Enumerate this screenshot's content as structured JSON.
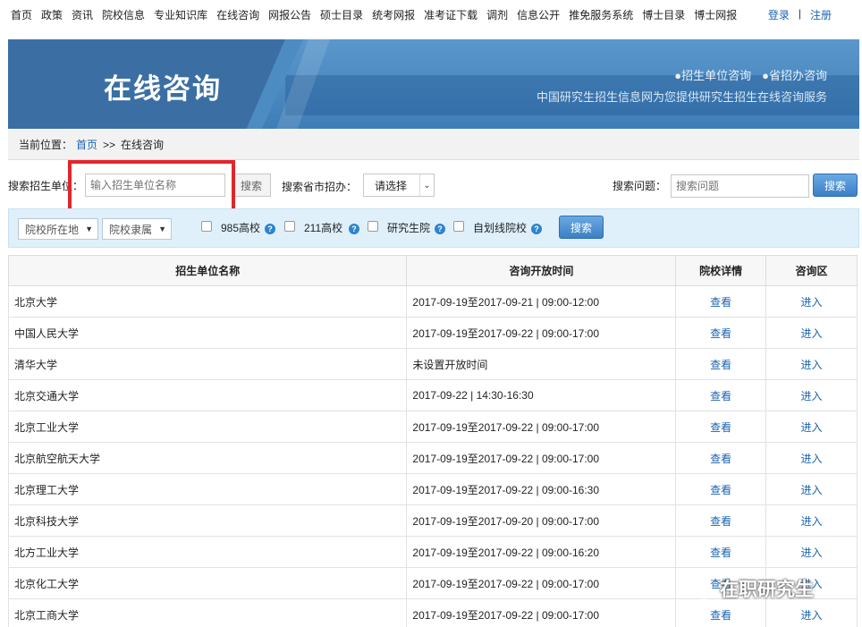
{
  "topnav": {
    "items": [
      "首页",
      "政策",
      "资讯",
      "院校信息",
      "专业知识库",
      "在线咨询",
      "网报公告",
      "硕士目录",
      "统考网报",
      "准考证下载",
      "调剂",
      "信息公开",
      "推免服务系统",
      "博士目录",
      "博士网报"
    ],
    "login": "登录",
    "separator": "|",
    "register": "注册"
  },
  "banner": {
    "title": "在线咨询",
    "link1": "●招生单位咨询",
    "link2": "●省招办咨询",
    "description": "中国研究生招生信息网为您提供研究生招生在线咨询服务"
  },
  "breadcrumb": {
    "prefix": "当前位置：",
    "home": "首页",
    "arrow": ">>",
    "current": "在线咨询"
  },
  "search": {
    "unit_label": "搜索招生单位：",
    "unit_placeholder": "输入招生单位名称",
    "unit_button": "搜索",
    "province_label": "搜索省市招办：",
    "province_select": "请选择",
    "question_label": "搜索问题：",
    "question_placeholder": "搜索问题",
    "question_button": "搜索"
  },
  "filter": {
    "location": "院校所在地",
    "affiliation": "院校隶属",
    "check985": "985高校",
    "check211": "211高校",
    "graduate_school": "研究生院",
    "self_line": "自划线院校",
    "button": "搜索",
    "help_glyph": "?"
  },
  "table": {
    "headers": [
      "招生单位名称",
      "咨询开放时间",
      "院校详情",
      "咨询区"
    ],
    "view_label": "查看",
    "enter_label": "进入",
    "rows": [
      {
        "name": "北京大学",
        "time": "2017-09-19至2017-09-21 | 09:00-12:00"
      },
      {
        "name": "中国人民大学",
        "time": "2017-09-19至2017-09-22 | 09:00-17:00"
      },
      {
        "name": "清华大学",
        "time": "未设置开放时间"
      },
      {
        "name": "北京交通大学",
        "time": "2017-09-22 | 14:30-16:30"
      },
      {
        "name": "北京工业大学",
        "time": "2017-09-19至2017-09-22 | 09:00-17:00"
      },
      {
        "name": "北京航空航天大学",
        "time": "2017-09-19至2017-09-22 | 09:00-17:00"
      },
      {
        "name": "北京理工大学",
        "time": "2017-09-19至2017-09-22 | 09:00-16:30"
      },
      {
        "name": "北京科技大学",
        "time": "2017-09-19至2017-09-20 | 09:00-17:00"
      },
      {
        "name": "北方工业大学",
        "time": "2017-09-19至2017-09-22 | 09:00-16:20"
      },
      {
        "name": "北京化工大学",
        "time": "2017-09-19至2017-09-22 | 09:00-17:00"
      },
      {
        "name": "北京工商大学",
        "time": "2017-09-19至2017-09-22 | 09:00-17:00"
      }
    ]
  },
  "watermark": "在职研究生",
  "colors": {
    "link": "#1b64b1",
    "banner": "#3a78b2",
    "highlight": "#e1262b"
  }
}
